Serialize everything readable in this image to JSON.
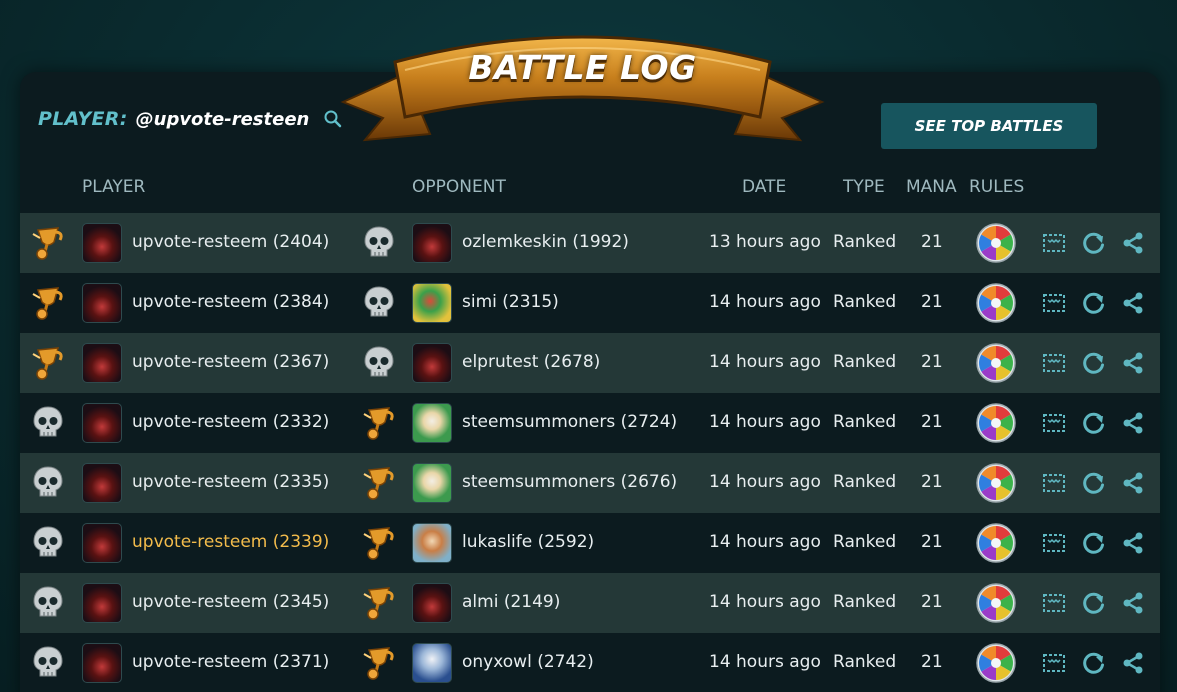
{
  "header": {
    "banner_title": "BATTLE LOG",
    "player_label": "PLAYER:",
    "player_value": "@upvote-resteen",
    "top_battles_button": "SEE TOP BATTLES"
  },
  "columns": {
    "player": "PLAYER",
    "opponent": "OPPONENT",
    "date": "DATE",
    "type": "TYPE",
    "mana": "MANA",
    "rules": "RULES"
  },
  "colors": {
    "accent": "#62c0cb",
    "highlight": "#f3bc4c",
    "button_bg": "#17555e"
  },
  "battles": [
    {
      "player_result": "winner-trophy-icon",
      "player": "upvote-resteem (2404)",
      "opponent_result": "loser-skull-icon",
      "opponent": "ozlemkeskin (1992)",
      "opponent_avatar": "dark",
      "date": "13 hours ago",
      "type": "Ranked",
      "mana": "21",
      "highlighted": false
    },
    {
      "player_result": "winner-trophy-icon",
      "player": "upvote-resteem (2384)",
      "opponent_result": "loser-skull-icon",
      "opponent": "simi (2315)",
      "opponent_avatar": "green-yellow",
      "date": "14 hours ago",
      "type": "Ranked",
      "mana": "21",
      "highlighted": false
    },
    {
      "player_result": "winner-trophy-icon",
      "player": "upvote-resteem (2367)",
      "opponent_result": "loser-skull-icon",
      "opponent": "elprutest (2678)",
      "opponent_avatar": "dark",
      "date": "14 hours ago",
      "type": "Ranked",
      "mana": "21",
      "highlighted": false
    },
    {
      "player_result": "loser-skull-icon",
      "player": "upvote-resteem (2332)",
      "opponent_result": "winner-trophy-icon",
      "opponent": "steemsummoners (2724)",
      "opponent_avatar": "green-white",
      "date": "14 hours ago",
      "type": "Ranked",
      "mana": "21",
      "highlighted": false
    },
    {
      "player_result": "loser-skull-icon",
      "player": "upvote-resteem (2335)",
      "opponent_result": "winner-trophy-icon",
      "opponent": "steemsummoners (2676)",
      "opponent_avatar": "green-white",
      "date": "14 hours ago",
      "type": "Ranked",
      "mana": "21",
      "highlighted": false
    },
    {
      "player_result": "loser-skull-icon",
      "player": "upvote-resteem (2339)",
      "opponent_result": "winner-trophy-icon",
      "opponent": "lukaslife (2592)",
      "opponent_avatar": "light",
      "date": "14 hours ago",
      "type": "Ranked",
      "mana": "21",
      "highlighted": true
    },
    {
      "player_result": "loser-skull-icon",
      "player": "upvote-resteem (2345)",
      "opponent_result": "winner-trophy-icon",
      "opponent": "almi (2149)",
      "opponent_avatar": "dark",
      "date": "14 hours ago",
      "type": "Ranked",
      "mana": "21",
      "highlighted": false
    },
    {
      "player_result": "loser-skull-icon",
      "player": "upvote-resteem (2371)",
      "opponent_result": "winner-trophy-icon",
      "opponent": "onyxowl (2742)",
      "opponent_avatar": "blue",
      "date": "14 hours ago",
      "type": "Ranked",
      "mana": "21",
      "highlighted": false
    }
  ]
}
